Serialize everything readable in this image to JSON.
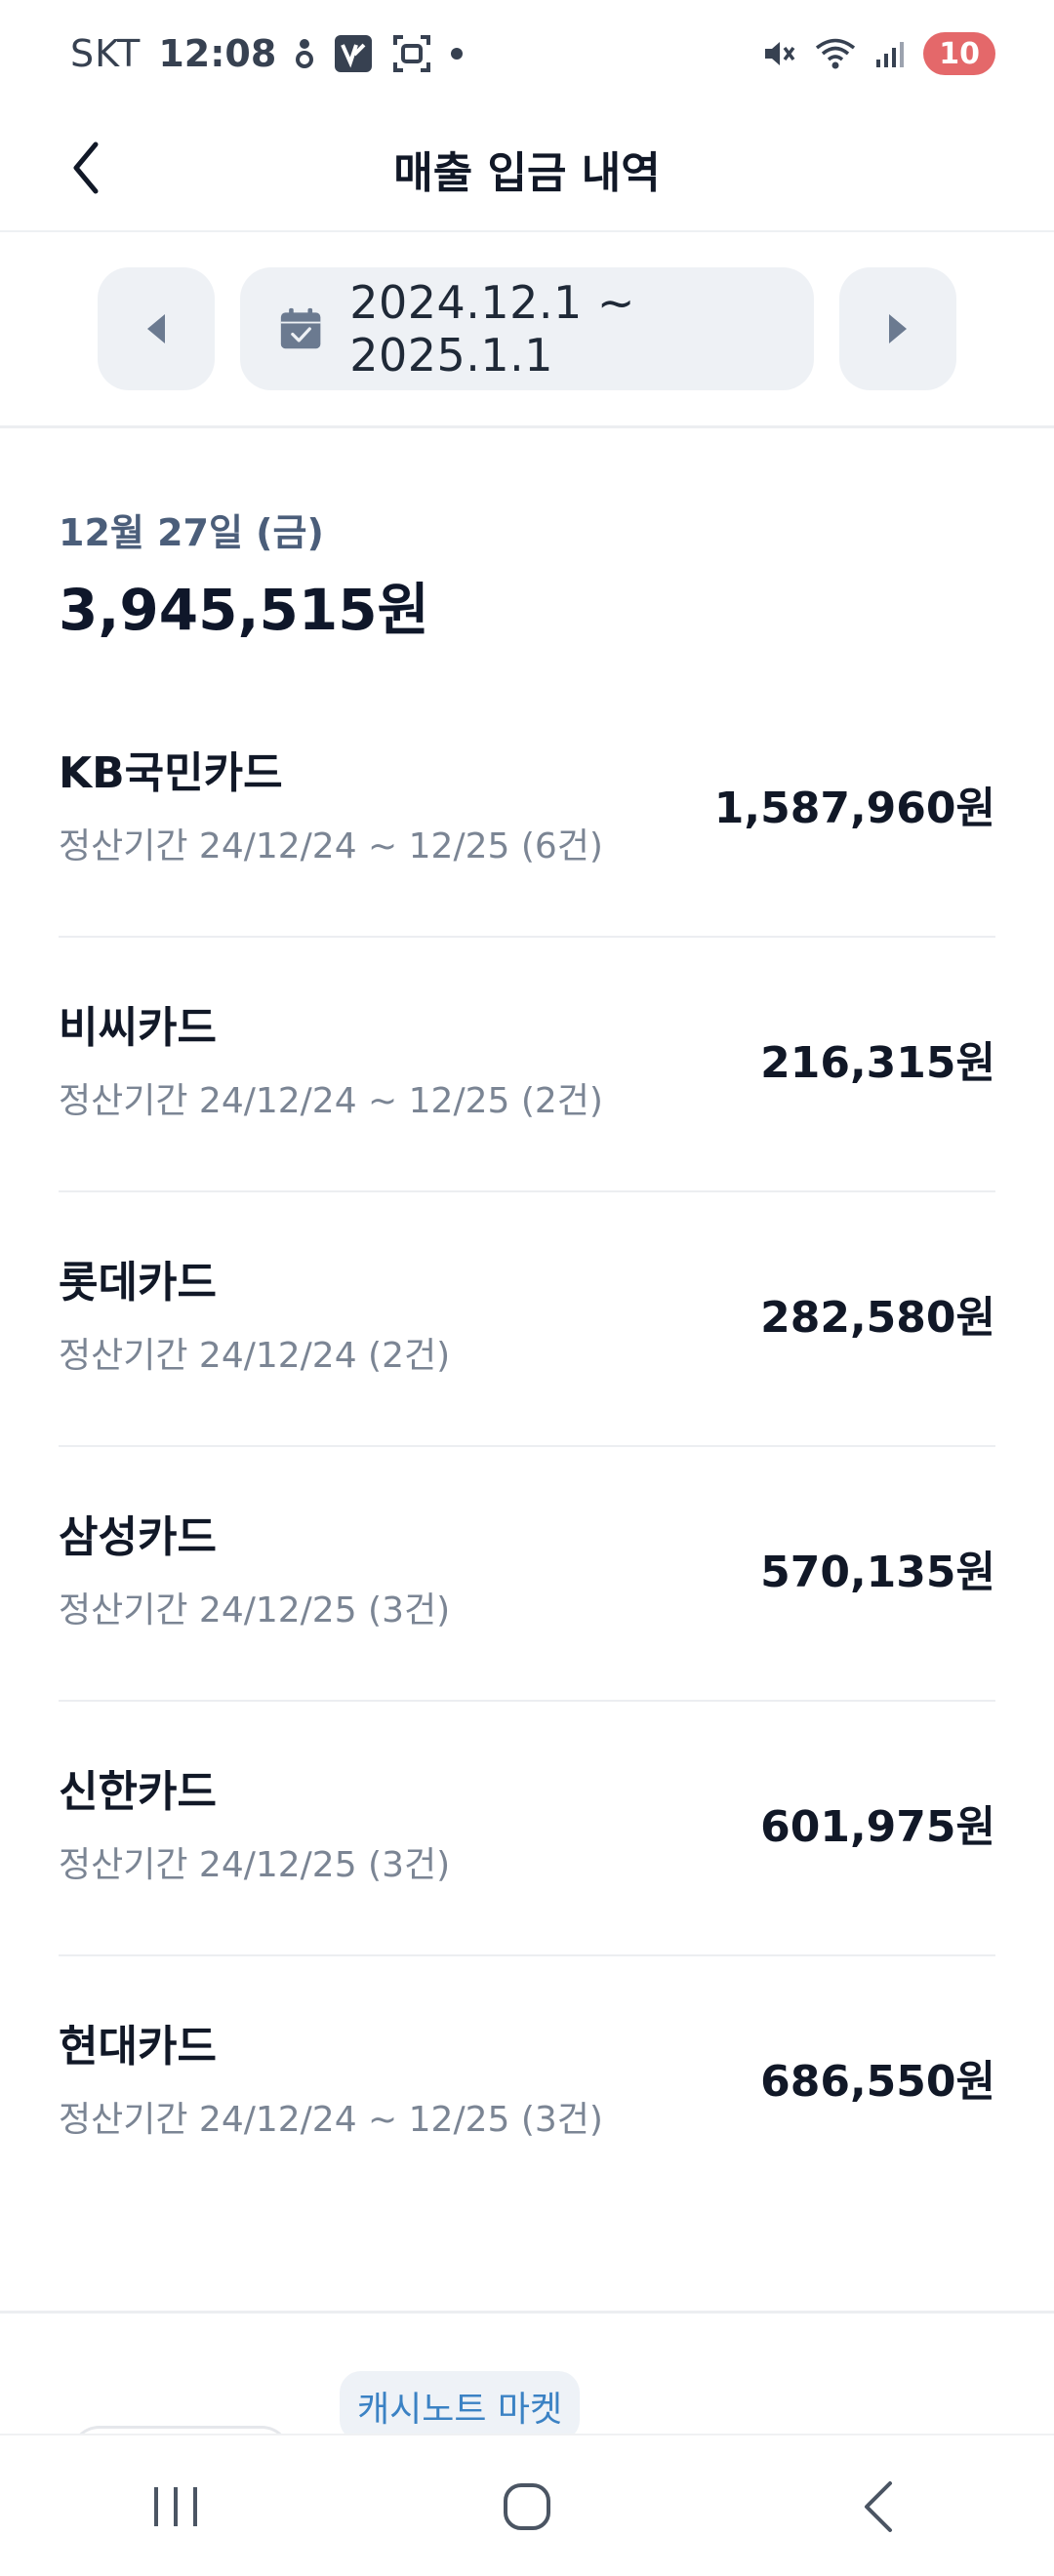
{
  "status_bar": {
    "carrier": "SKT",
    "time": "12:08",
    "battery": "10"
  },
  "header": {
    "title": "매출 입금 내역"
  },
  "date_range": {
    "label": "2024.12.1 ~ 2025.1.1"
  },
  "summary": {
    "date": "12월 27일 (금)",
    "total": "3,945,515원"
  },
  "deposits": [
    {
      "name": "KB국민카드",
      "period": "정산기간 24/12/24 ~ 12/25 (6건)",
      "amount": "1,587,960원"
    },
    {
      "name": "비씨카드",
      "period": "정산기간 24/12/24 ~ 12/25 (2건)",
      "amount": "216,315원"
    },
    {
      "name": "롯데카드",
      "period": "정산기간 24/12/24 (2건)",
      "amount": "282,580원"
    },
    {
      "name": "삼성카드",
      "period": "정산기간 24/12/25 (3건)",
      "amount": "570,135원"
    },
    {
      "name": "신한카드",
      "period": "정산기간 24/12/25 (3건)",
      "amount": "601,975원"
    },
    {
      "name": "현대카드",
      "period": "정산기간 24/12/24 ~ 12/25 (3건)",
      "amount": "686,550원"
    }
  ],
  "footer": {
    "market_badge": "캐시노트 마켓"
  },
  "icons": {
    "back": "chevron-left-icon",
    "calendar": "calendar-check-icon",
    "prev": "triangle-left-icon",
    "next": "triangle-right-icon"
  },
  "colors": {
    "accent_text": "#4b5e7a",
    "pill_bg": "#eef1f5",
    "badge_text": "#3b82c4"
  }
}
